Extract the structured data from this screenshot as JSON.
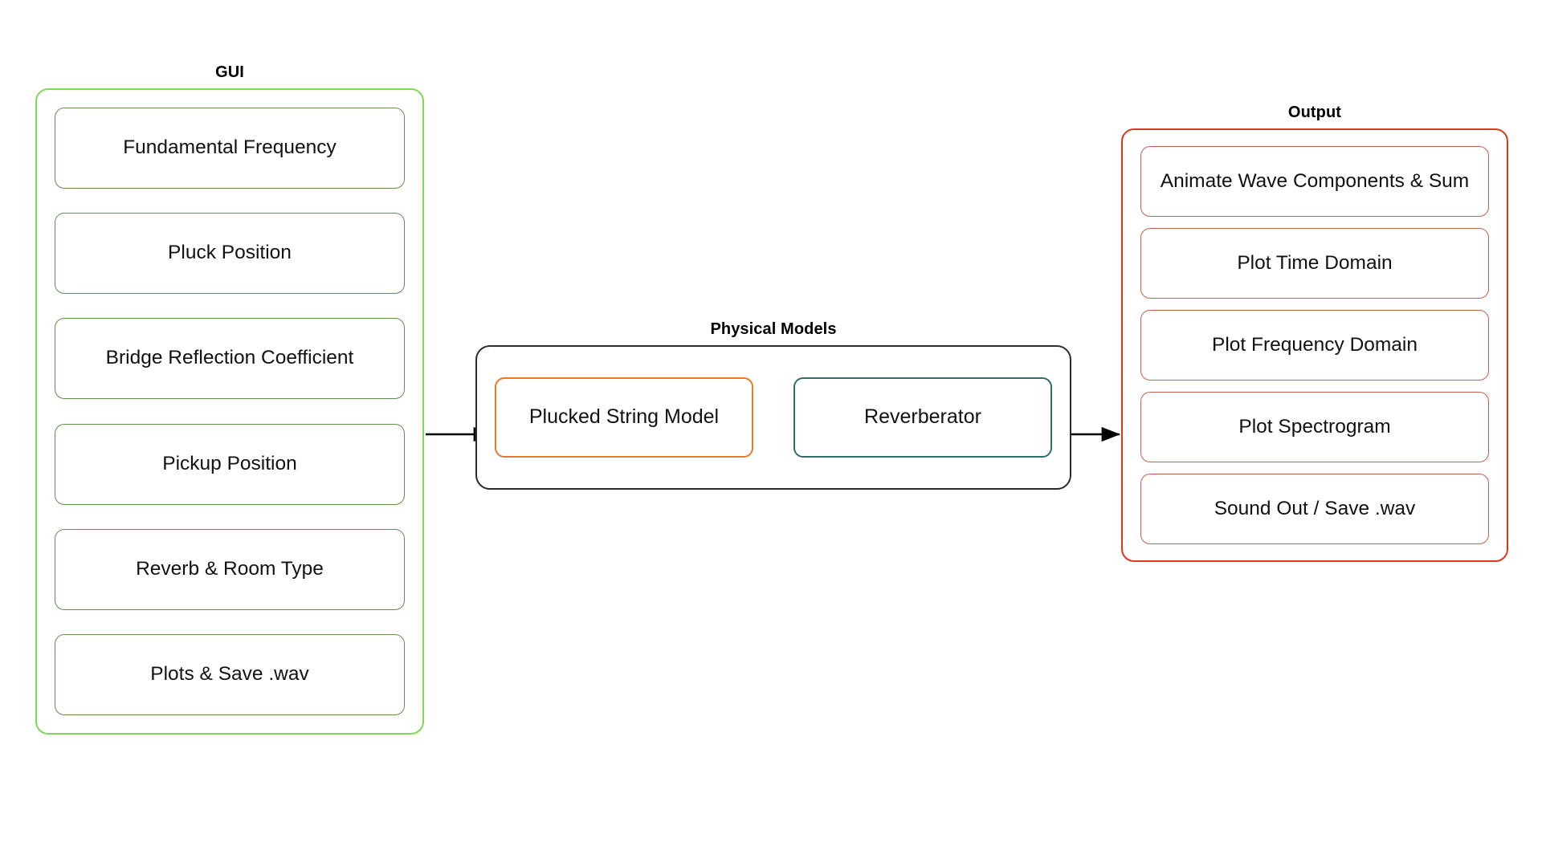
{
  "diagram": {
    "title_style": "bold",
    "background": "#ffffff",
    "colors": {
      "gui_container_border": "#7ED957",
      "gui_item_border": "#5F8E4E",
      "physical_models_container_border": "#2B2B2B",
      "plucked_string_border": "#E8792B",
      "reverberator_border": "#2E6C6A",
      "output_container_border": "#DB3A1B",
      "output_item_border": "#C5604E",
      "arrow": "#000000",
      "text": "#111111"
    }
  },
  "gui": {
    "title": "GUI",
    "items": [
      {
        "label": "Fundamental Frequency"
      },
      {
        "label": "Pluck Position"
      },
      {
        "label": "Bridge Reflection Coefficient"
      },
      {
        "label": "Pickup Position"
      },
      {
        "label": "Reverb & Room Type"
      },
      {
        "label": "Plots & Save .wav"
      }
    ]
  },
  "physical_models": {
    "title": "Physical Models",
    "items": [
      {
        "label": "Plucked String Model",
        "accent": "orange"
      },
      {
        "label": "Reverberator",
        "accent": "teal"
      }
    ]
  },
  "output": {
    "title": "Output",
    "items": [
      {
        "label": "Animate Wave Components & Sum"
      },
      {
        "label": "Plot Time Domain"
      },
      {
        "label": "Plot Frequency Domain"
      },
      {
        "label": "Plot Spectrogram"
      },
      {
        "label": "Sound Out / Save .wav"
      }
    ]
  },
  "connectors": [
    {
      "name": "gui-to-physical-models",
      "from": "GUI",
      "to": "Plucked String Model"
    },
    {
      "name": "plucked-string-to-reverberator",
      "from": "Plucked String Model",
      "to": "Reverberator"
    },
    {
      "name": "physical-models-to-output",
      "from": "Reverberator",
      "to": "Output"
    }
  ]
}
